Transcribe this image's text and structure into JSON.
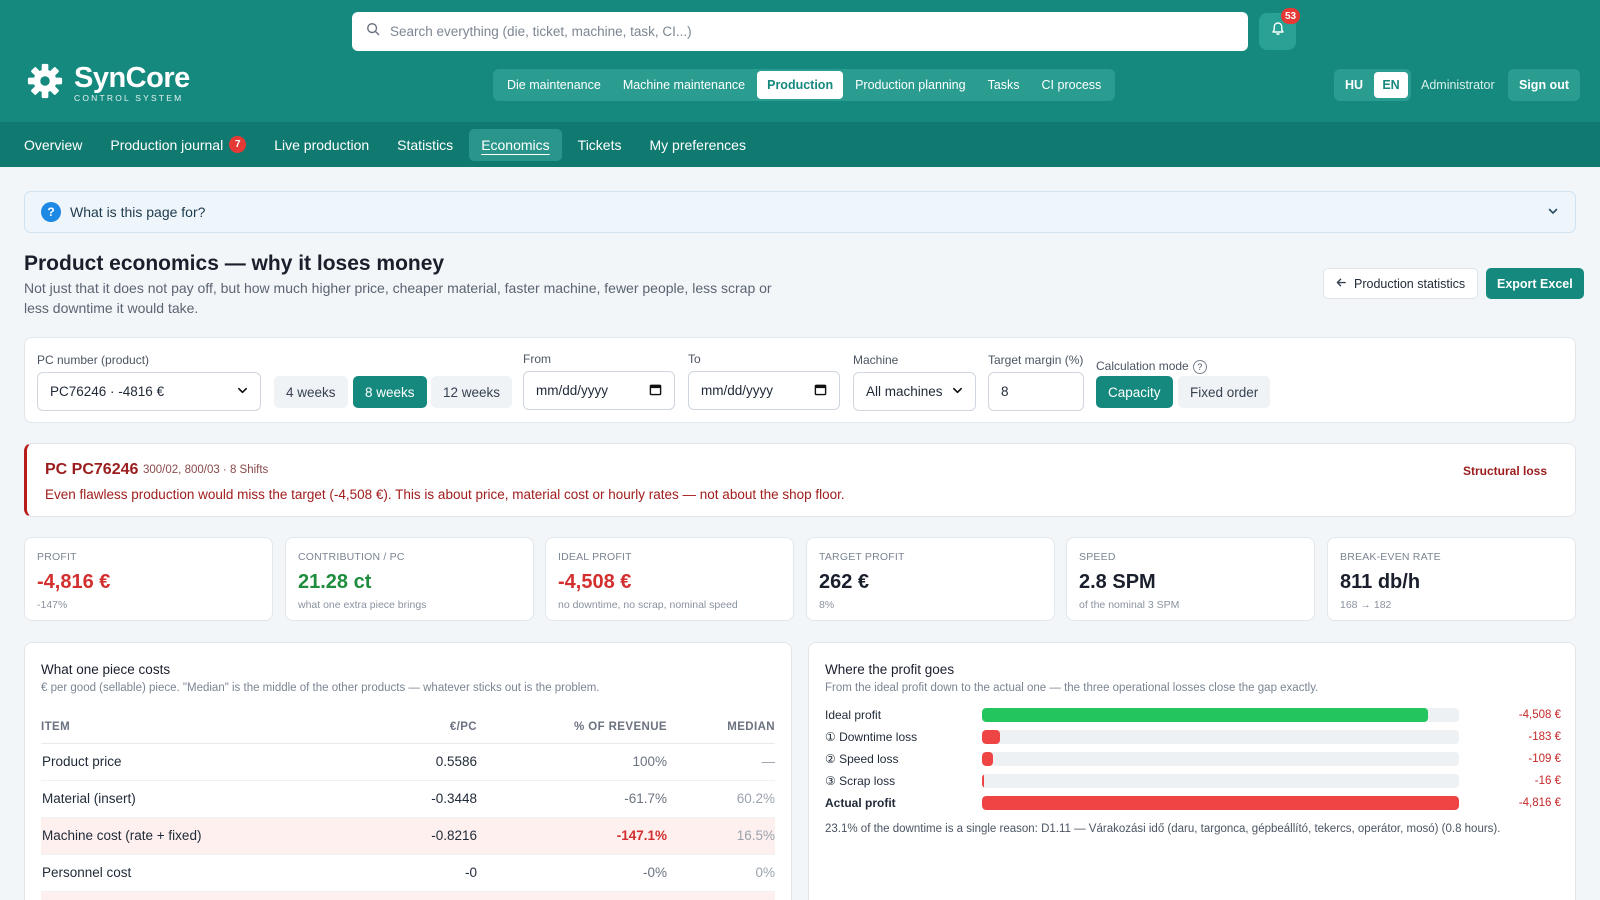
{
  "header": {
    "search_placeholder": "Search everything (die, ticket, machine, task, CI...)",
    "notification_count": "53",
    "logo_name": "SynCore",
    "logo_sub": "CONTROL SYSTEM",
    "modules": [
      {
        "label": "Die maintenance",
        "active": false
      },
      {
        "label": "Machine maintenance",
        "active": false
      },
      {
        "label": "Production",
        "active": true
      },
      {
        "label": "Production planning",
        "active": false
      },
      {
        "label": "Tasks",
        "active": false
      },
      {
        "label": "CI process",
        "active": false
      }
    ],
    "lang_hu": "HU",
    "lang_en": "EN",
    "user": "Administrator",
    "sign_out": "Sign out"
  },
  "subnav": {
    "tabs": [
      {
        "label": "Overview"
      },
      {
        "label": "Production journal",
        "badge": "7"
      },
      {
        "label": "Live production"
      },
      {
        "label": "Statistics"
      },
      {
        "label": "Economics",
        "active": true
      },
      {
        "label": "Tickets"
      },
      {
        "label": "My preferences"
      }
    ]
  },
  "help": {
    "icon": "?",
    "title": "What is this page for?"
  },
  "page": {
    "title": "Product economics — why it loses money",
    "subtitle": "Not just that it does not pay off, but how much higher price, cheaper material, faster machine, fewer people, less scrap or less downtime it would take.",
    "back_button": "Production statistics",
    "export_button": "Export Excel"
  },
  "filters": {
    "pc_label": "PC number (product)",
    "pc_value": "PC76246 · -4816 €",
    "periods": [
      {
        "label": "4 weeks",
        "active": false
      },
      {
        "label": "8 weeks",
        "active": true
      },
      {
        "label": "12 weeks",
        "active": false
      }
    ],
    "from_label": "From",
    "from_placeholder": "mm/dd/yyyy",
    "to_label": "To",
    "to_placeholder": "mm/dd/yyyy",
    "machine_label": "Machine",
    "machine_value": "All machines",
    "margin_label": "Target margin (%)",
    "margin_value": "8",
    "calc_label": "Calculation mode",
    "calc_help": "?",
    "calc_modes": [
      {
        "label": "Capacity",
        "active": true
      },
      {
        "label": "Fixed order",
        "active": false
      }
    ]
  },
  "loss": {
    "code": "PC PC76246",
    "meta": "300/02, 800/03 · 8 Shifts",
    "message": "Even flawless production would miss the target (-4,508 €). This is about price, material cost or hourly rates — not about the shop floor.",
    "tag": "Structural loss"
  },
  "kpis": [
    {
      "label": "PROFIT",
      "value": "-4,816 €",
      "sub": "-147%",
      "tone": "red"
    },
    {
      "label": "CONTRIBUTION / PC",
      "value": "21.28 ct",
      "sub": "what one extra piece brings",
      "tone": "green"
    },
    {
      "label": "IDEAL PROFIT",
      "value": "-4,508 €",
      "sub": "no downtime, no scrap, nominal speed",
      "tone": "red"
    },
    {
      "label": "TARGET PROFIT",
      "value": "262 €",
      "sub": "8%",
      "tone": "dark"
    },
    {
      "label": "SPEED",
      "value": "2.8 SPM",
      "sub": "of the nominal 3 SPM",
      "tone": "dark"
    },
    {
      "label": "BREAK-EVEN RATE",
      "value": "811 db/h",
      "sub": "168 → 182",
      "tone": "dark"
    }
  ],
  "cost": {
    "title": "What one piece costs",
    "subtitle": "€ per good (sellable) piece. \"Median\" is the middle of the other products — whatever sticks out is the problem.",
    "headers": [
      "ITEM",
      "€/PC",
      "% OF REVENUE",
      "MEDIAN"
    ],
    "rows": [
      {
        "item": "Product price",
        "eur": "0.5586",
        "pct": "100%",
        "median": "—",
        "highlight": false
      },
      {
        "item": "Material (insert)",
        "eur": "-0.3448",
        "pct": "-61.7%",
        "median": "60.2%",
        "highlight": false
      },
      {
        "item": "Machine cost (rate + fixed)",
        "eur": "-0.8216",
        "pct": "-147.1%",
        "median": "16.5%",
        "highlight": true
      },
      {
        "item": "Personnel cost",
        "eur": "-0",
        "pct": "-0%",
        "median": "0%",
        "highlight": false
      }
    ]
  },
  "profit": {
    "title": "Where the profit goes",
    "subtitle": "From the ideal profit down to the actual one — the three operational losses close the gap exactly.",
    "rows": [
      {
        "label": "Ideal profit",
        "value": "-4,508 €",
        "fraction": 0.936,
        "color": "#22c55e",
        "bold": false
      },
      {
        "label": "① Downtime loss",
        "value": "-183 €",
        "fraction": 0.038,
        "color": "#ef4444",
        "bold": false
      },
      {
        "label": "② Speed loss",
        "value": "-109 €",
        "fraction": 0.023,
        "color": "#ef4444",
        "bold": false
      },
      {
        "label": "③ Scrap loss",
        "value": "-16 €",
        "fraction": 0.004,
        "color": "#ef4444",
        "bold": false
      },
      {
        "label": "Actual profit",
        "value": "-4,816 €",
        "fraction": 1.0,
        "color": "#ef4444",
        "bold": true
      }
    ],
    "note": "23.1% of the downtime is a single reason: D1.11 — Várakozási idő (daru, targonca, gépbeállító, tekercs, operátor, mosó) (0.8 hours)."
  },
  "colors": {
    "brand": "#15897e",
    "loss": "#d32f2f",
    "gain": "#1e8e3e"
  }
}
